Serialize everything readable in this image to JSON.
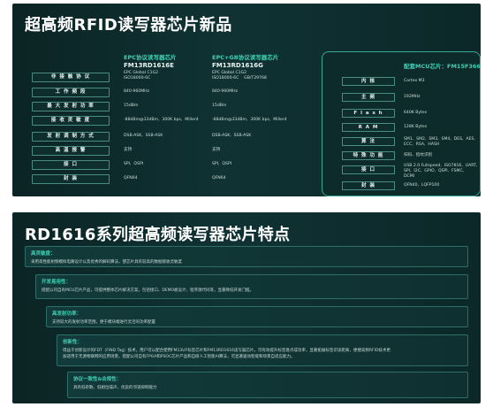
{
  "panel1": {
    "title": "超高频RFID读写器芯片新品",
    "chips": [
      {
        "series": "EPC协议读写器芯片",
        "model": "FM13RD1616E"
      },
      {
        "series": "EPC+GB协议读写器芯片",
        "model": "FM13RD1616G"
      }
    ],
    "rows": [
      {
        "label": "非 接 触 协 议",
        "v1": "EPC Global C1G2\nISO18000-6C",
        "v2": "EPC Global C1G2\nISO18000-6C    GB/T29768"
      },
      {
        "label": "工 作 频 段",
        "v1": "840-960MHz",
        "v2": "840-960MHz"
      },
      {
        "label": "最 大 发 射 功 率",
        "v1": "15dBm",
        "v2": "15dBm"
      },
      {
        "label": "接 收 灵 敏 度",
        "v1": "-88dBm@33dBm,  300K bps,  Miller4",
        "v2": "-88dBm@33dBm,  300K bps,  Miller4"
      },
      {
        "label": "发 射 调 制 方 式",
        "v1": "DSB-ASK,  SSB-ASK",
        "v2": "DSB-ASK,  SSB-ASK"
      },
      {
        "label": "高 温 报 警",
        "v1": "支持",
        "v2": "支持"
      },
      {
        "label": "接 口",
        "v1": "SPI,  QSPI",
        "v2": "SPI,  QSPI"
      },
      {
        "label": "封 装",
        "v1": "QFN64",
        "v2": "QFN64"
      }
    ],
    "mcu": {
      "title": "配套MCU芯片：FM15F366",
      "rows": [
        {
          "label": "内 核",
          "value": "Cortex M3"
        },
        {
          "label": "主 频",
          "value": "192MHz"
        },
        {
          "label": "F l a s h",
          "value": "640K Bytes"
        },
        {
          "label": "R A M",
          "value": "128K Bytes"
        },
        {
          "label": "算 法",
          "value": "SM1,  SM2,  SM3,  SM4,  DES,  AES,\nECC,  RSA,  HASH"
        },
        {
          "label": "特 殊 功 能",
          "value": "扫码、指纹识别"
        },
        {
          "label": "接 口",
          "value": "USB 2.0 Fullspeed,  ISO7816,  UART,\nSPI,  I2C,  GPIO,  QSPI,  FSMC,\nDCMI"
        },
        {
          "label": "封 装",
          "value": "QFN40,  LQFP100"
        }
      ]
    }
  },
  "panel2": {
    "title": "RD1616系列超高频读写器芯片特点",
    "features": [
      {
        "title": "高灵敏度：",
        "desc": "采用高性能射频模拟电路设计以及优秀的解码算法，使芯片具有较高的数据接收灵敏度"
      },
      {
        "title": "开发易用性：",
        "desc": "搭配公司自有MCU芯片产品，可提供整体芯片解决方案，包括接口、DEMO板设计、程序源代码等，显著降低开发门槛。"
      },
      {
        "title": "高发射功率：",
        "desc": "支持较大的发射功率范围，便于模块端进行灵活的功率配置"
      },
      {
        "title": "创新性：",
        "desc": "得益于创新设计的FDT（FIND Tag）技术，用户可以配合使用FM13UF标签芯片和FM13RD1616读写器芯片，可有效提升标签盘点成功率，显著拓展标签识读距离，便捷高频RFID技术更\n加适用于无源物联网的应用场景，搭配公司自有FPGA和PSOC芯片产品和自研人工智能AI算法，可显著驱动智能和场景自适应能力。"
      },
      {
        "title": "协议一致性&合规性：",
        "desc": "具有低杂散，低相位噪声，优良的邻道抑制能力"
      }
    ]
  }
}
